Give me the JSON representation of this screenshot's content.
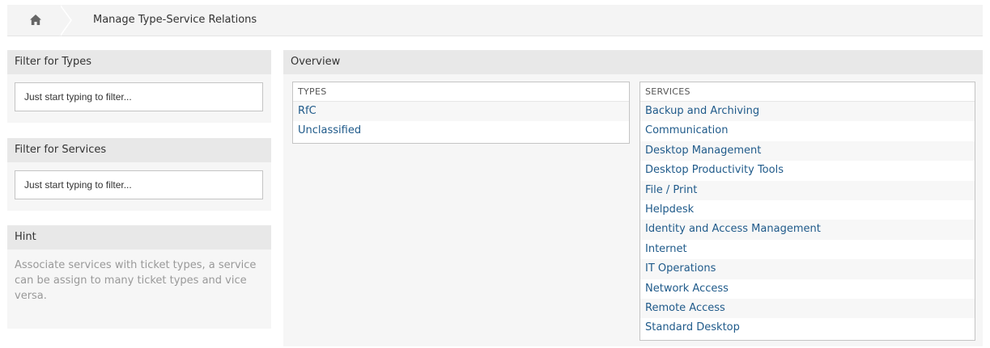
{
  "breadcrumb": {
    "home_icon": "home-icon",
    "title": "Manage Type-Service Relations"
  },
  "filter_types": {
    "title": "Filter for Types",
    "placeholder": "Just start typing to filter..."
  },
  "filter_services": {
    "title": "Filter for Services",
    "placeholder": "Just start typing to filter..."
  },
  "hint": {
    "title": "Hint",
    "text": "Associate services with ticket types, a service can be assign to many ticket types and vice versa."
  },
  "overview": {
    "title": "Overview",
    "types": {
      "header": "TYPES",
      "items": [
        "RfC",
        "Unclassified"
      ]
    },
    "services": {
      "header": "SERVICES",
      "items": [
        "Backup and Archiving",
        "Communication",
        "Desktop Management",
        "Desktop Productivity Tools",
        "File / Print",
        "Helpdesk",
        "Identity and Access Management",
        "Internet",
        "IT Operations",
        "Network Access",
        "Remote Access",
        "Standard Desktop"
      ]
    }
  },
  "colors": {
    "link": "#1f5a8a",
    "header_bg": "#e8e8e8",
    "panel_bg": "#f6f6f6",
    "hint_text": "#999999"
  }
}
